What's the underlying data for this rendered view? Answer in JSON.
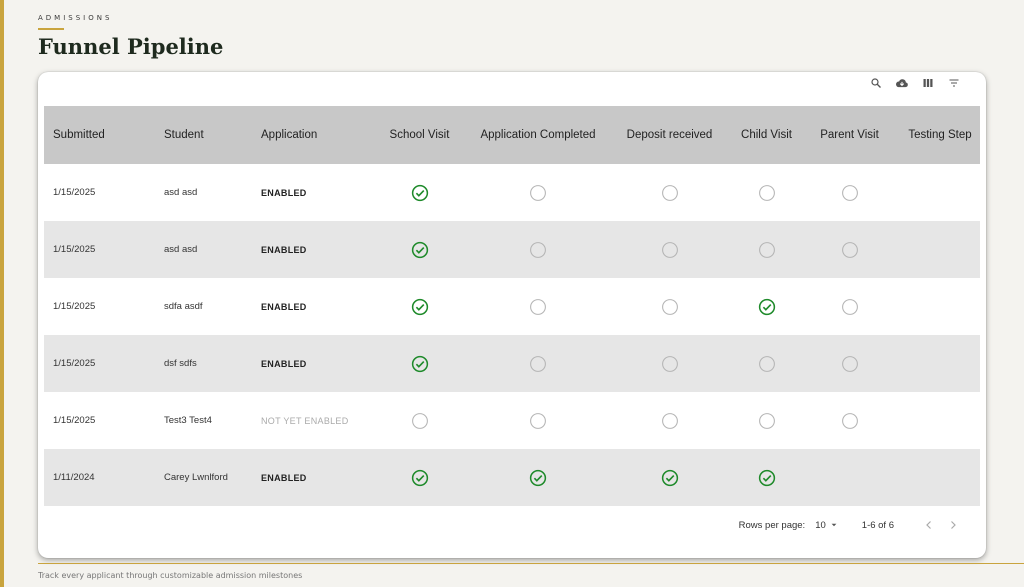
{
  "header": {
    "eyebrow": "ADMISSIONS",
    "title": "Funnel Pipeline"
  },
  "toolbar": {
    "icons": [
      "search-icon",
      "cloud-download-icon",
      "view-column-icon",
      "filter-icon"
    ]
  },
  "table": {
    "columns": {
      "submitted": "Submitted",
      "student": "Student",
      "application": "Application",
      "school_visit": "School Visit",
      "application_completed": "Application Completed",
      "deposit_received": "Deposit received",
      "child_visit": "Child Visit",
      "parent_visit": "Parent Visit",
      "testing_step": "Testing Step"
    },
    "rows": [
      {
        "submitted": "1/15/2025",
        "student": "asd asd",
        "application": "ENABLED",
        "application_enabled": true,
        "steps": [
          "done",
          "pending",
          "pending",
          "pending",
          "pending",
          "none"
        ]
      },
      {
        "submitted": "1/15/2025",
        "student": "asd asd",
        "application": "ENABLED",
        "application_enabled": true,
        "steps": [
          "done",
          "pending",
          "pending",
          "pending",
          "pending",
          "none"
        ]
      },
      {
        "submitted": "1/15/2025",
        "student": "sdfa asdf",
        "application": "ENABLED",
        "application_enabled": true,
        "steps": [
          "done",
          "pending",
          "pending",
          "done",
          "pending",
          "none"
        ]
      },
      {
        "submitted": "1/15/2025",
        "student": "dsf sdfs",
        "application": "ENABLED",
        "application_enabled": true,
        "steps": [
          "done",
          "pending",
          "pending",
          "pending",
          "pending",
          "none"
        ]
      },
      {
        "submitted": "1/15/2025",
        "student": "Test3 Test4",
        "application": "NOT YET ENABLED",
        "application_enabled": false,
        "steps": [
          "pending",
          "pending",
          "pending",
          "pending",
          "pending",
          "none"
        ]
      },
      {
        "submitted": "1/11/2024",
        "student": "Carey Lwnlford",
        "application": "ENABLED",
        "application_enabled": true,
        "steps": [
          "done",
          "done",
          "done",
          "done",
          "none",
          "none"
        ]
      }
    ]
  },
  "pagination": {
    "rows_per_page_label": "Rows per page:",
    "rows_per_page_value": "10",
    "range": "1-6 of 6"
  },
  "footer": {
    "tagline": "Track every applicant through customizable admission milestones"
  },
  "colors": {
    "accent": "#c9a43e",
    "check_green": "#1e8a2a",
    "pending_gray": "#b5b5b5"
  }
}
